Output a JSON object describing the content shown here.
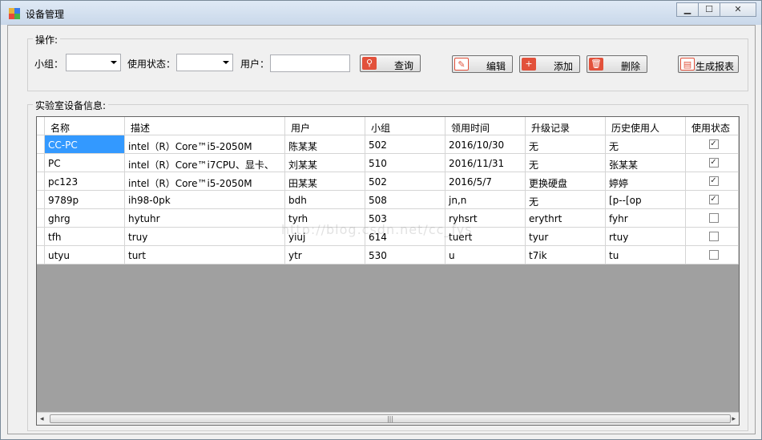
{
  "window": {
    "title": "设备管理",
    "min_label": "▁",
    "max_label": "☐",
    "close_label": "✕"
  },
  "ops": {
    "legend": "操作:",
    "group_label": "小组：",
    "status_label": "使用状态：",
    "user_label": "用户：",
    "group_value": "",
    "status_value": "",
    "user_value": "",
    "query_label": "查询",
    "edit_label": "编辑",
    "add_label": "添加",
    "delete_label": "删除",
    "report_label": "生成报表"
  },
  "info": {
    "legend": "实验室设备信息:"
  },
  "table": {
    "columns": [
      "名称",
      "描述",
      "用户",
      "小组",
      "领用时间",
      "升级记录",
      "历史使用人",
      "使用状态"
    ],
    "rows": [
      [
        "CC-PC",
        "intel（R）Core™i5-2050M",
        "陈某某",
        "502",
        "2016/10/30",
        "无",
        "无",
        true
      ],
      [
        "PC",
        "intel（R）Core™i7CPU、显卡、",
        "刘某某",
        "510",
        "2016/11/31",
        "无",
        "张某某",
        true
      ],
      [
        "pc123",
        "intel（R）Core™i5-2050M",
        "田某某",
        "502",
        "2016/5/7",
        "更换硬盘",
        "婷婷",
        true
      ],
      [
        "9789p",
        "ih98-0pk",
        "bdh",
        "508",
        "jn,n",
        "无",
        "[p--[op",
        true
      ],
      [
        "ghrg",
        "hytuhr",
        "tyrh",
        "503",
        "ryhsrt",
        "erythrt",
        "fyhr",
        false
      ],
      [
        " tfh",
        "truy",
        "yiuj",
        "614",
        "tuert",
        "tyur",
        "rtuy",
        false
      ],
      [
        "utyu",
        "turt",
        "ytr",
        "530",
        "u",
        "t7ik",
        "tu",
        false
      ]
    ]
  },
  "watermark": "http://blog.csdn.net/cc_fys",
  "colors": {
    "selection": "#3399ff",
    "grid_bg": "#a0a0a0",
    "icon_red": "#e2513b"
  }
}
